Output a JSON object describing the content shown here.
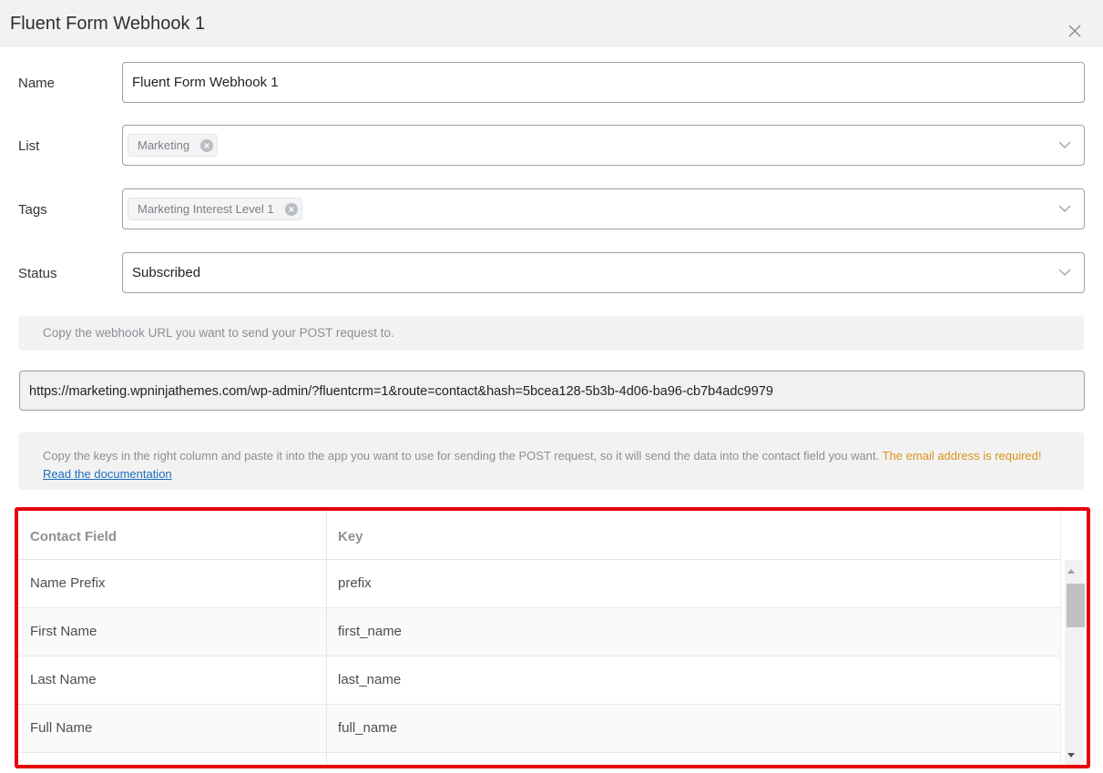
{
  "dialog": {
    "title": "Fluent Form Webhook 1",
    "close_icon": "close-icon"
  },
  "form": {
    "name": {
      "label": "Name",
      "value": "Fluent Form Webhook 1"
    },
    "list": {
      "label": "List",
      "selected_tag": "Marketing"
    },
    "tags": {
      "label": "Tags",
      "selected_tag": "Marketing Interest Level 1"
    },
    "status": {
      "label": "Status",
      "value": "Subscribed"
    }
  },
  "webhook": {
    "instruction": "Copy the webhook URL you want to send your POST request to.",
    "url": "https://marketing.wpninjathemes.com/wp-admin/?fluentcrm=1&route=contact&hash=5bcea128-5b3b-4d06-ba96-cb7b4adc9979",
    "keys_instruction": "Copy the keys in the right column and paste it into the app you want to use for sending the POST request, so it will send the data into the contact field you want.",
    "warning": "The email address is required!",
    "doc_link": "Read the documentation"
  },
  "table": {
    "headers": {
      "field": "Contact Field",
      "key": "Key"
    },
    "rows": [
      {
        "field": "Name Prefix",
        "key": "prefix"
      },
      {
        "field": "First Name",
        "key": "first_name"
      },
      {
        "field": "Last Name",
        "key": "last_name"
      },
      {
        "field": "Full Name",
        "key": "full_name"
      },
      {
        "field": "",
        "key": ""
      }
    ]
  },
  "colors": {
    "highlight_border": "#e8000b",
    "warning_text": "#d9941b",
    "link": "#1a6fc0"
  }
}
